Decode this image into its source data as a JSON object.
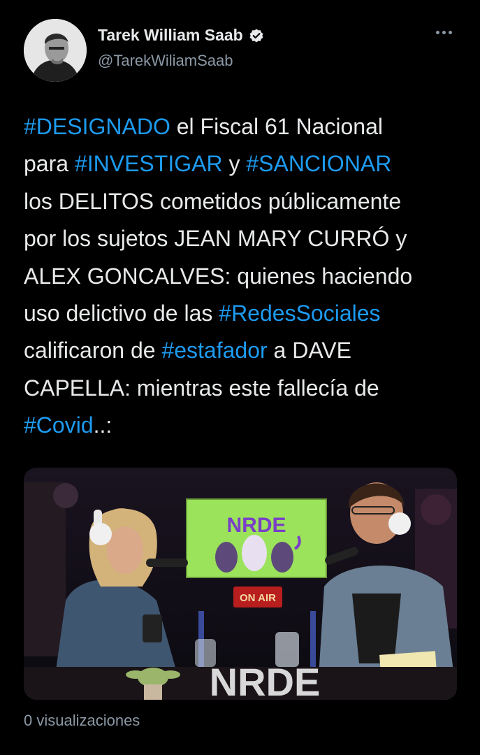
{
  "author": {
    "name": "Tarek William Saab",
    "handle": "@TarekWiliamSaab",
    "verified": true
  },
  "icons": {
    "verified": "verified-badge-icon",
    "more": "more-options-icon"
  },
  "tweet": {
    "lines": [
      [
        {
          "t": "#DESIGNADO",
          "tag": true
        },
        {
          "t": " el Fiscal 61 Nacional",
          "tag": false
        }
      ],
      [
        {
          "t": "para ",
          "tag": false
        },
        {
          "t": "#INVESTIGAR",
          "tag": true
        },
        {
          "t": " y ",
          "tag": false
        },
        {
          "t": "#SANCIONAR",
          "tag": true
        }
      ],
      [
        {
          "t": "los DELITOS cometidos públicamente",
          "tag": false
        }
      ],
      [
        {
          "t": "por los sujetos JEAN MARY CURRÓ  y",
          "tag": false
        }
      ],
      [
        {
          "t": "ALEX GONCALVES: quienes haciendo",
          "tag": false
        }
      ],
      [
        {
          "t": "uso delictivo de las ",
          "tag": false
        },
        {
          "t": "#RedesSociales",
          "tag": true
        }
      ],
      [
        {
          "t": "calificaron de ",
          "tag": false
        },
        {
          "t": "#estafador",
          "tag": true
        },
        {
          "t": " a DAVE",
          "tag": false
        }
      ],
      [
        {
          "t": "CAPELLA: mientras este fallecía de",
          "tag": false
        }
      ],
      [
        {
          "t": "#Covid",
          "tag": true
        },
        {
          "t": "..:",
          "tag": false
        }
      ]
    ]
  },
  "media": {
    "screen_logo": "NRDE",
    "on_air_sign": "ON AIR",
    "desk_logo": "NRDE"
  },
  "footer": {
    "views": "0 visualizaciones"
  },
  "colors": {
    "background": "#000000",
    "text": "#e7e9ea",
    "secondary": "#8b98a5",
    "hashtag": "#1d9bf0"
  }
}
